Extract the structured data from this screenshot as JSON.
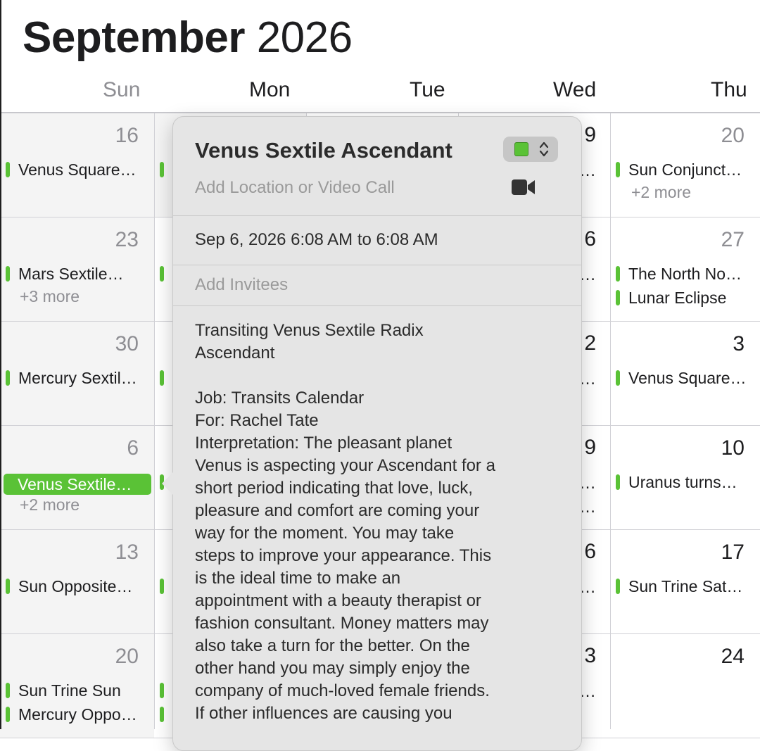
{
  "header": {
    "month": "September",
    "year": "2026"
  },
  "weekdays": [
    "Sun",
    "Mon",
    "Tue",
    "Wed",
    "Thu"
  ],
  "weeks": [
    {
      "sun": {
        "day": "16",
        "events": [
          "Venus Square…"
        ],
        "more": ""
      },
      "wed_peek": [
        "9",
        "…"
      ],
      "thu": {
        "day": "20",
        "events": [
          "Sun Conjunct…"
        ],
        "more": "+2 more"
      }
    },
    {
      "sun": {
        "day": "23",
        "events": [
          "Mars Sextile…"
        ],
        "more": "+3 more"
      },
      "wed_peek": [
        "6",
        "…"
      ],
      "thu": {
        "day": "27",
        "events": [
          "The North No…",
          "Lunar Eclipse"
        ],
        "more": ""
      }
    },
    {
      "sun": {
        "day": "30",
        "events": [
          "Mercury Sextil…"
        ],
        "more": ""
      },
      "wed_peek": [
        "2",
        "…"
      ],
      "thu": {
        "day": "3",
        "events": [
          "Venus Square…"
        ],
        "more": ""
      }
    },
    {
      "sun": {
        "day": "6",
        "events": [
          "Venus Sextile…"
        ],
        "more": "+2 more"
      },
      "wed_peek": [
        "9",
        "e…",
        "…"
      ],
      "thu": {
        "day": "10",
        "events": [
          "Uranus turns…"
        ],
        "more": ""
      }
    },
    {
      "sun": {
        "day": "13",
        "events": [
          "Sun Opposite…"
        ],
        "more": ""
      },
      "wed_peek": [
        "6",
        "a…"
      ],
      "thu": {
        "day": "17",
        "events": [
          "Sun Trine Sat…"
        ],
        "more": ""
      }
    },
    {
      "sun": {
        "day": "20",
        "events": [
          "Sun Trine Sun",
          "Mercury Oppo…"
        ],
        "more": ""
      },
      "wed_peek": [
        "3",
        "S…"
      ],
      "thu": {
        "day": "24",
        "events": [],
        "more": ""
      }
    }
  ],
  "popover": {
    "title": "Venus Sextile Ascendant",
    "location_placeholder": "Add Location or Video Call",
    "datetime": "Sep 6, 2026  6:08 AM to 6:08 AM",
    "invitees_placeholder": "Add Invitees",
    "notes_lines": [
      "Transiting Venus Sextile Radix",
      "Ascendant",
      "",
      "Job: Transits Calendar",
      "For: Rachel Tate",
      "Interpretation: The pleasant planet",
      "Venus is aspecting your Ascendant for a",
      "short period indicating that love, luck,",
      "pleasure and comfort are coming your",
      "way for the moment. You may take",
      "steps to improve your appearance. This",
      "is the ideal time to make an",
      "appointment with a beauty therapist or",
      "fashion consultant. Money matters may",
      "also take a turn for the better. On the",
      "other hand you may simply enjoy the",
      "company of much-loved female friends.",
      "If other influences are causing you"
    ],
    "calendar_color": "#5ac236"
  },
  "colors": {
    "accent": "#5ac236",
    "weekend_bg": "#f4f4f4",
    "popover_bg": "#e5e5e5"
  },
  "icons": {
    "color_chevrons": "up-down-chevron-icon",
    "video": "video-camera-icon"
  }
}
